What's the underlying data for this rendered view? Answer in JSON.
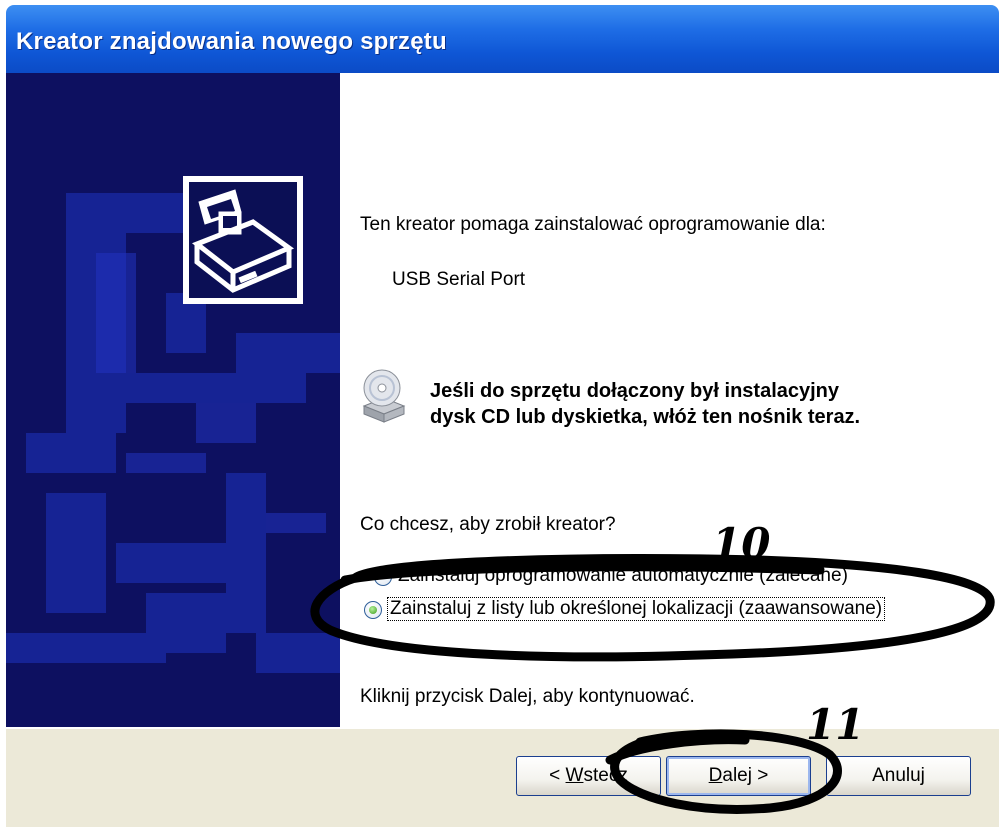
{
  "window": {
    "title": "Kreator znajdowania nowego sprzętu",
    "titlebar_color": "#0f57d6"
  },
  "content": {
    "intro": "Ten kreator pomaga zainstalować oprogramowanie dla:",
    "device_name": "USB Serial Port",
    "cd_notice_line1": "Jeśli do sprzętu dołączony był instalacyjny",
    "cd_notice_line2": "dysk CD lub dyskietka, włóż ten nośnik teraz.",
    "question": "Co chcesz, aby zrobił kreator?",
    "options": [
      {
        "label": "Zainstaluj oprogramowanie automatycznie (zalecane)",
        "selected": false
      },
      {
        "label": "Zainstaluj z listy lub określonej lokalizacji (zaawansowane)",
        "selected": true
      }
    ],
    "continue_hint": "Kliknij przycisk Dalej, aby kontynuować."
  },
  "buttons": {
    "back": {
      "prefix": "< ",
      "mnemonic": "W",
      "rest": "stecz"
    },
    "next": {
      "mnemonic": "D",
      "rest": "alej >"
    },
    "cancel": "Anuluj"
  },
  "annotations": {
    "mark_10": "10",
    "mark_11": "11"
  },
  "icons": [
    "hardware-wizard-icon",
    "cd-drive-icon"
  ]
}
